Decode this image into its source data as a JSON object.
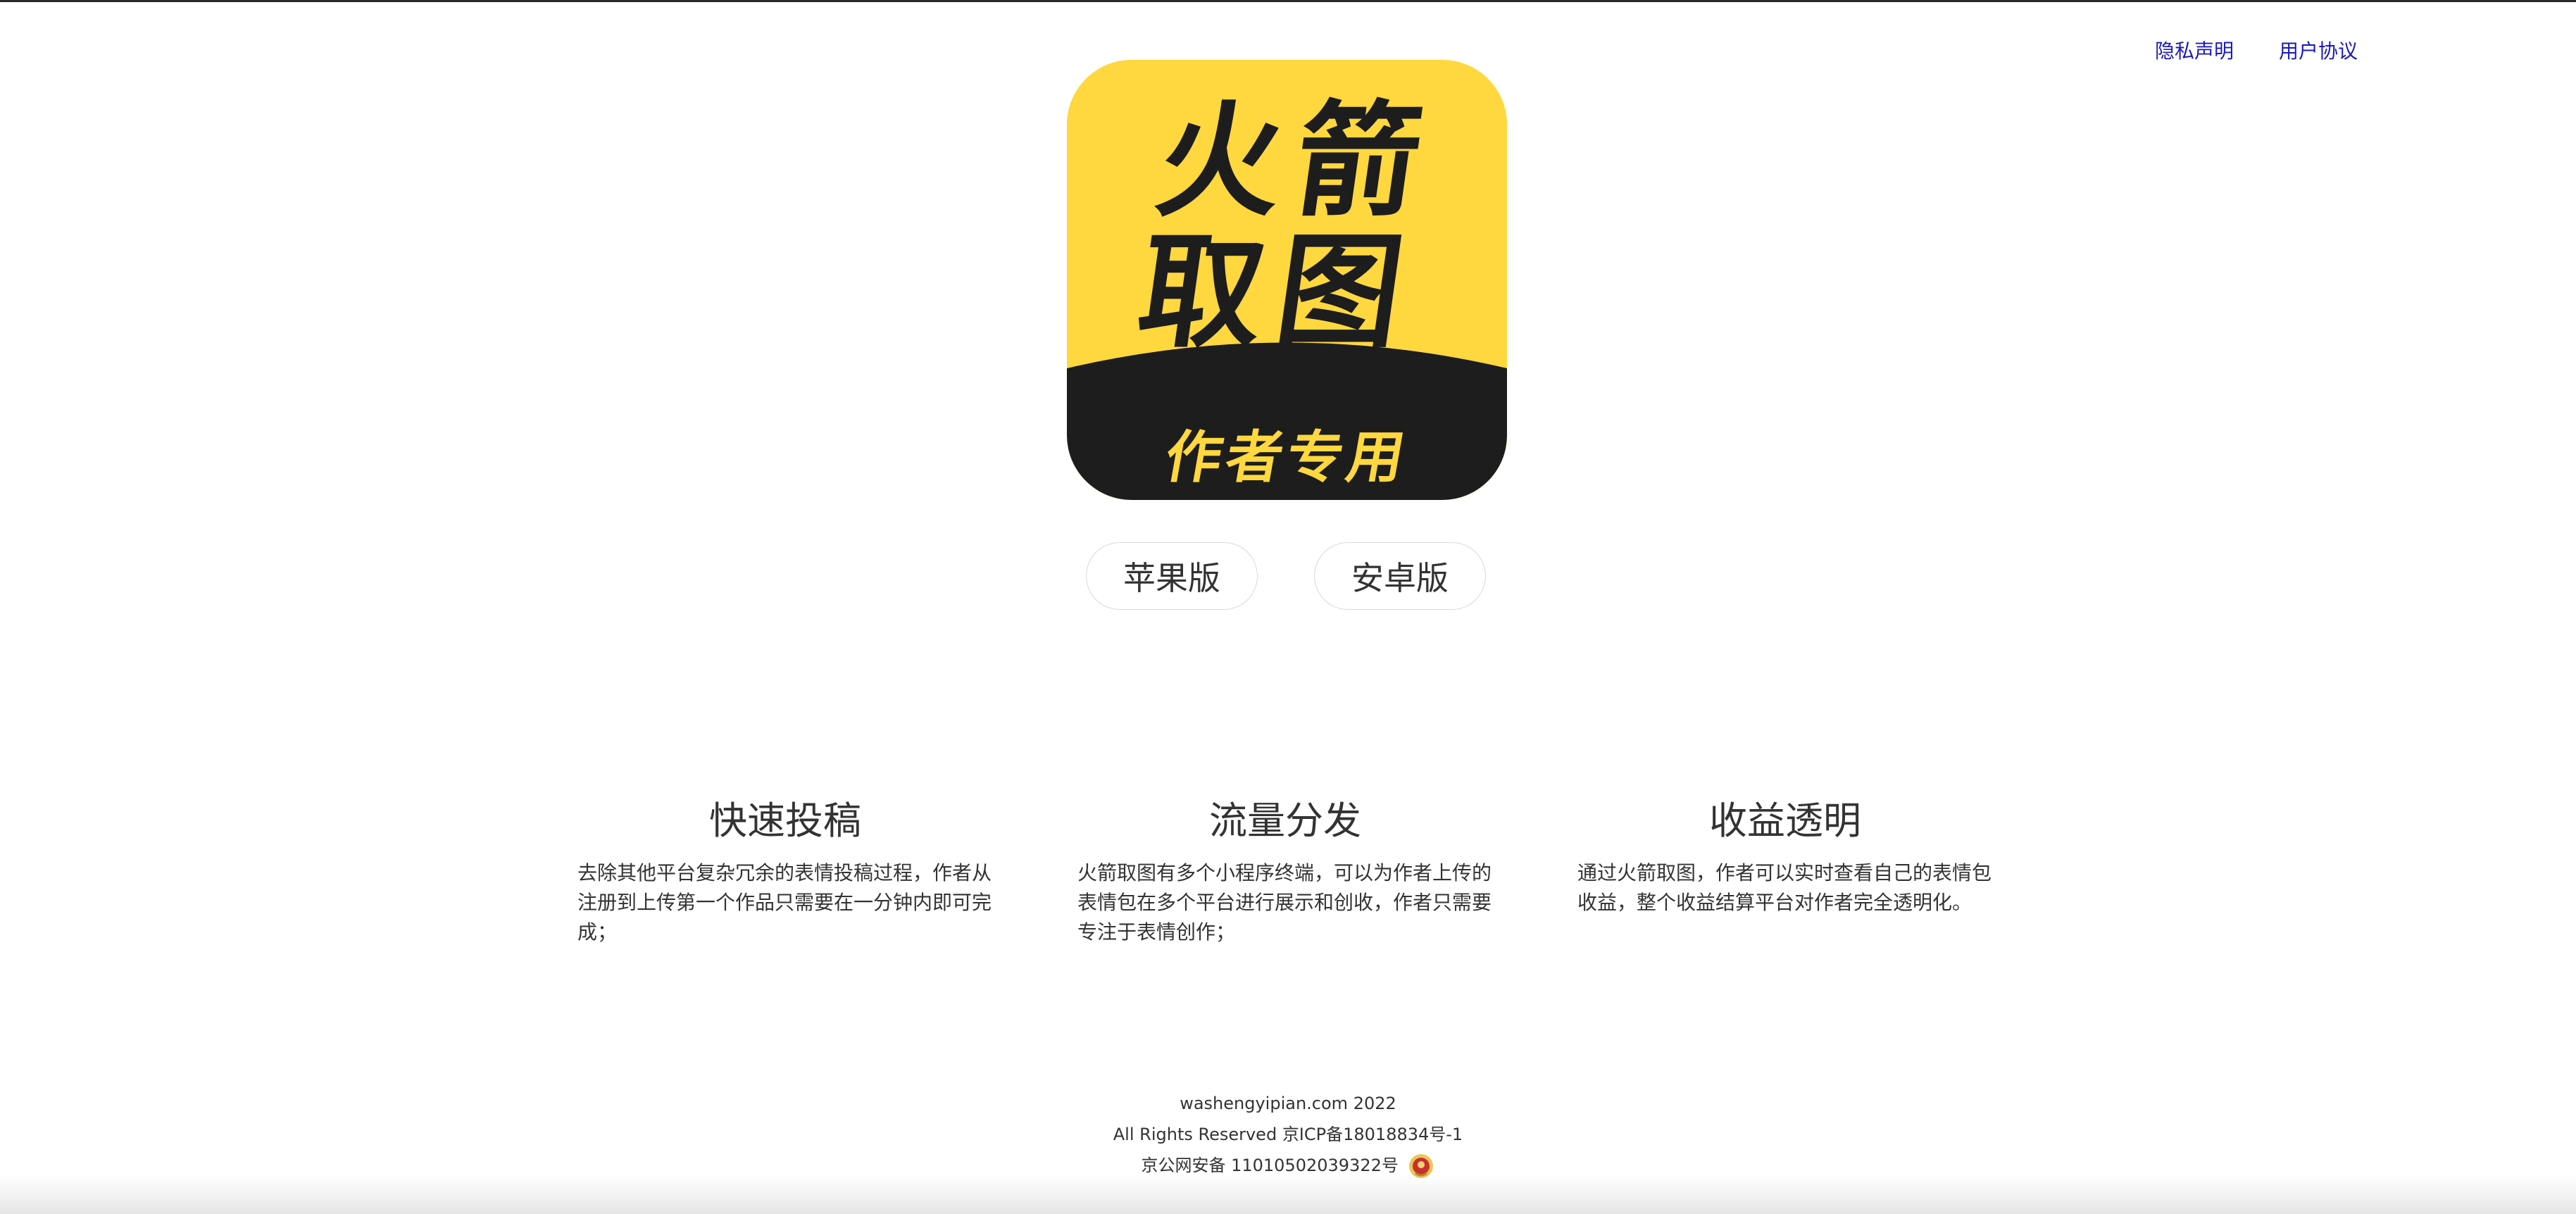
{
  "nav": {
    "privacy": "隐私声明",
    "agreement": "用户协议"
  },
  "app_icon": {
    "title_line1": "火箭",
    "title_line2": "取图",
    "subtitle": "作者专用",
    "colors": {
      "yellow": "#ffd83f",
      "dark": "#1d1d1d"
    }
  },
  "downloads": {
    "ios": "苹果版",
    "android": "安卓版"
  },
  "features": [
    {
      "title": "快速投稿",
      "desc": "去除其他平台复杂冗余的表情投稿过程，作者从注册到上传第一个作品只需要在一分钟内即可完成；"
    },
    {
      "title": "流量分发",
      "desc": "火箭取图有多个小程序终端，可以为作者上传的表情包在多个平台进行展示和创收，作者只需要专注于表情创作；"
    },
    {
      "title": "收益透明",
      "desc": "通过火箭取图，作者可以实时查看自己的表情包收益，整个收益结算平台对作者完全透明化。"
    }
  ],
  "footer": {
    "domain": "washengyipian.com 2022",
    "rights": "All Rights Reserved 京ICP备18018834号-1",
    "police": "京公网安备 11010502039322号",
    "police_icon": "police-badge-icon"
  },
  "colors": {
    "link": "#1a1ab8",
    "text": "#333333"
  }
}
